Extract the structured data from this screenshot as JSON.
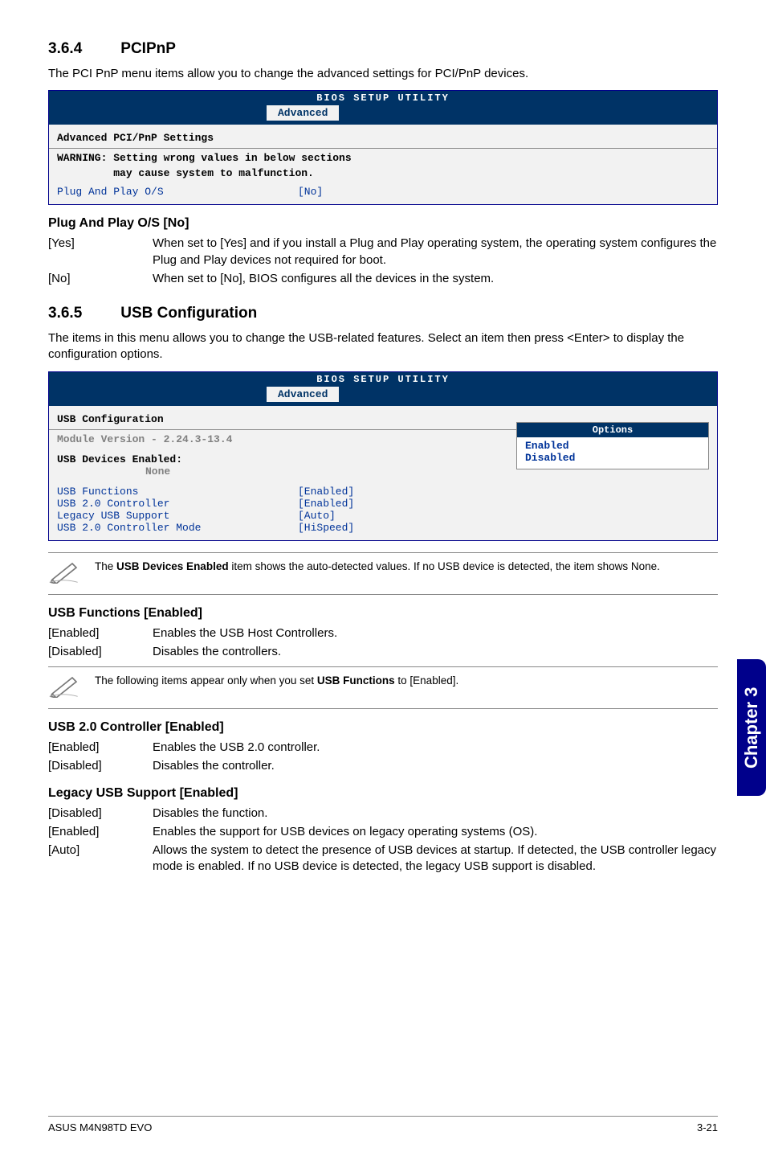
{
  "sections": {
    "pcipnp": {
      "num": "3.6.4",
      "title": "PCIPnP"
    },
    "usbconf": {
      "num": "3.6.5",
      "title": "USB Configuration"
    }
  },
  "pcipnp_intro": "The PCI PnP menu items allow you to change the advanced settings for PCI/PnP devices.",
  "bios1": {
    "header": "BIOS SETUP UTILITY",
    "tab": "Advanced",
    "section_title": "Advanced PCI/PnP Settings",
    "warning_l1": "WARNING: Setting wrong values in below sections",
    "warning_l2": "         may cause system to malfunction.",
    "kv": {
      "k": "Plug And Play O/S",
      "v": "[No]"
    }
  },
  "plugplay": {
    "heading": "Plug And Play O/S [No]",
    "rows": [
      {
        "term": "[Yes]",
        "def": "When set to [Yes] and if you install a Plug and Play operating system, the operating system configures the Plug and Play devices not required for boot."
      },
      {
        "term": "[No]",
        "def": "When set to [No], BIOS configures all the devices in the system."
      }
    ]
  },
  "usbconf_intro": "The items in this menu allows you to change the USB-related features. Select an item then press <Enter> to display the configuration options.",
  "bios2": {
    "header": "BIOS SETUP UTILITY",
    "tab": "Advanced",
    "section_title": "USB Configuration",
    "module_line": "Module Version - 2.24.3-13.4",
    "devices_title": "USB Devices Enabled:",
    "devices_value": "None",
    "rows": [
      {
        "k": "USB Functions",
        "v": "[Enabled]"
      },
      {
        "k": "USB 2.0 Controller",
        "v": "[Enabled]"
      },
      {
        "k": "Legacy USB Support",
        "v": "[Auto]"
      },
      {
        "k": "USB 2.0 Controller Mode",
        "v": "[HiSpeed]"
      }
    ],
    "options_title": "Options",
    "options": [
      "Enabled",
      "Disabled"
    ]
  },
  "note1_prefix": "The ",
  "note1_bold": "USB Devices Enabled",
  "note1_suffix": " item shows the auto-detected values. If no USB device is detected, the item shows None.",
  "usbfunc": {
    "heading": "USB Functions [Enabled]",
    "rows": [
      {
        "term": "[Enabled]",
        "def": "Enables the USB Host Controllers."
      },
      {
        "term": "[Disabled]",
        "def": "Disables the controllers."
      }
    ]
  },
  "note2_prefix": "The following items appear only when you set ",
  "note2_bold": "USB Functions",
  "note2_suffix": " to [Enabled].",
  "usb20": {
    "heading": "USB 2.0 Controller [Enabled]",
    "rows": [
      {
        "term": "[Enabled]",
        "def": "Enables the USB 2.0 controller."
      },
      {
        "term": "[Disabled]",
        "def": "Disables the controller."
      }
    ]
  },
  "legacy": {
    "heading": "Legacy USB Support [Enabled]",
    "rows": [
      {
        "term": "[Disabled]",
        "def": "Disables the function."
      },
      {
        "term": "[Enabled]",
        "def": "Enables the support for USB devices on legacy operating systems (OS)."
      },
      {
        "term": "[Auto]",
        "def": "Allows the system to detect the presence of USB devices at startup. If detected, the USB controller legacy mode is enabled. If no USB device is detected, the legacy USB support is disabled."
      }
    ]
  },
  "sidetab": "Chapter 3",
  "footer": {
    "left": "ASUS M4N98TD EVO",
    "right": "3-21"
  }
}
